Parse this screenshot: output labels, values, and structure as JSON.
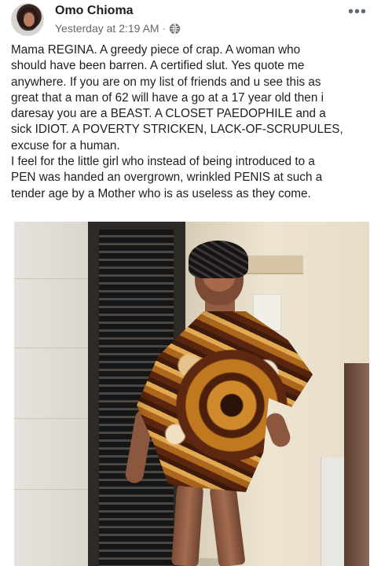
{
  "post": {
    "author": "Omo Chioma",
    "timestamp": "Yesterday at 2:19 AM",
    "separator": "·",
    "privacy_icon": "globe-icon",
    "more_icon": "more-options-icon",
    "text_lines": [
      "Mama REGINA.  A greedy piece of crap. A woman who",
      "should have been barren. A certified slut. Yes quote me",
      "anywhere. If you are on my list of friends and u see this as",
      "great that a man of 62 will have a go at a 17 year old then i",
      "daresay you are a BEAST. A CLOSET PAEDOPHILE and a",
      "sick IDIOT. A POVERTY STRICKEN, LACK-OF-SCRUPULES,",
      "excuse for a human.",
      "I feel for the little girl who instead of being introduced to a",
      "PEN was handed an overgrown, wrinkled PENIS at such a",
      "tender age by a Mother who is as useless as they come."
    ],
    "colors": {
      "text": "#1c1e21",
      "secondary_text": "#65676b",
      "background": "#ffffff"
    }
  }
}
